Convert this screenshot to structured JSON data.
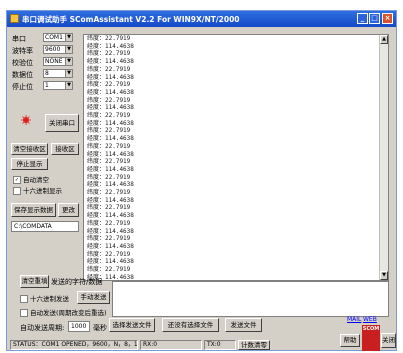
{
  "window": {
    "title": "串口调试助手 SComAssistant V2.2 For WIN9X/NT/2000",
    "min_label": "_",
    "max_label": "□",
    "close_label": "×"
  },
  "settings": {
    "port_label": "串口",
    "port_value": "COM1",
    "baud_label": "波特率",
    "baud_value": "9600",
    "parity_label": "校验位",
    "parity_value": "NONE",
    "data_label": "数据位",
    "data_value": "8",
    "stop_label": "停止位",
    "stop_value": "1",
    "dropdown_arrow": "▼",
    "close_port_button": "关闭串口"
  },
  "receive_controls": {
    "clear_button": "清空接收区",
    "receive_button": "接收区",
    "stop_display_button": "停止显示",
    "auto_clear_label": "自动清空",
    "auto_clear_checked": true,
    "hex_display_label": "十六进制显示",
    "hex_display_checked": false,
    "save_button": "保存显示数据",
    "change_button": "更改",
    "path_value": "C:\\COMDATA",
    "check_mark": "✓"
  },
  "receive_lines": [
    "纬度：22.7919",
    "经度：114.4638",
    "纬度：22.7919",
    "经度：114.4638",
    "纬度：22.7919",
    "经度：114.4638",
    "纬度：22.7919",
    "经度：114.4638",
    "纬度：22.7919",
    "经度：114.4638",
    "纬度：22.7919",
    "经度：114.4638",
    "纬度：22.7919",
    "经度：114.4638",
    "纬度：22.7919",
    "经度：114.4638",
    "纬度：22.7919",
    "经度：114.4638",
    "纬度：22.7919",
    "经度：114.4638",
    "纬度：22.7919",
    "经度：114.4638",
    "纬度：22.7919",
    "经度：114.4638",
    "纬度：22.7919",
    "经度：114.4638",
    "纬度：22.7919",
    "经度：114.4638",
    "纬度：22.7919",
    "经度：114.4638",
    "纬度：22.7919",
    "经度：114.4638"
  ],
  "send_controls": {
    "clear_send_button": "清空重填",
    "send_area_label": "发送的字符/数据",
    "hex_send_label": "十六进制发送",
    "manual_send_button": "手动发送",
    "auto_send_label": "自动发送(周期改变后重选)",
    "period_label": "自动发送周期:",
    "period_value": "1000",
    "period_unit": "毫秒",
    "select_file_button": "选择发送文件",
    "no_file_button": "还没有选择文件",
    "send_file_button": "发送文件",
    "send_text": ""
  },
  "status": {
    "state": "STATUS：COM1 OPENED，9600，N，8，1",
    "rx": "RX:0",
    "tx": "TX:0",
    "reset_button": "计数清零"
  },
  "footer": {
    "mail_link": "MAIL",
    "web_link": "WEB",
    "help_button": "帮助",
    "logo_text": "SCOM",
    "close_app_button": "关闭程序"
  }
}
